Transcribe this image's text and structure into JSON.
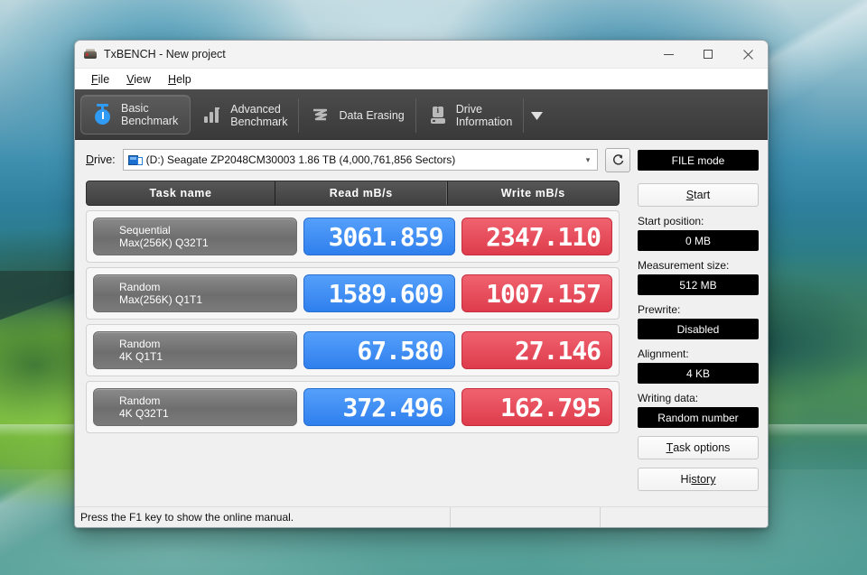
{
  "window": {
    "title": "TxBENCH - New project",
    "icon": "app-icon",
    "controls": {
      "minimize": "minimize-icon",
      "maximize": "maximize-icon",
      "close": "close-icon"
    }
  },
  "menubar": {
    "items": [
      {
        "pre": "F",
        "mnemonic": "",
        "label": "File",
        "m_first": "F",
        "m_rest": "ile"
      },
      {
        "label": "View",
        "m_first": "V",
        "m_rest": "iew"
      },
      {
        "label": "Help",
        "m_first": "H",
        "m_rest": "elp"
      }
    ]
  },
  "toolbar": {
    "tabs": [
      {
        "line1": "Basic",
        "line2": "Benchmark",
        "icon": "stopwatch-icon",
        "active": true
      },
      {
        "line1": "Advanced",
        "line2": "Benchmark",
        "icon": "bar-chart-icon",
        "active": false
      },
      {
        "line1": "Data Erasing",
        "line2": "",
        "icon": "shredder-icon",
        "active": false
      },
      {
        "line1": "Drive",
        "line2": "Information",
        "icon": "drive-info-icon",
        "active": false
      }
    ],
    "overflow_icon": "chevron-down-icon"
  },
  "drive_row": {
    "label": "Drive:",
    "selected": "(D:) Seagate ZP2048CM30003  1.86 TB (4,000,761,856 Sectors)",
    "dropdown_icon": "chevron-down-icon",
    "refresh_icon": "refresh-icon"
  },
  "results": {
    "columns": [
      "Task name",
      "Read mB/s",
      "Write mB/s"
    ],
    "rows": [
      {
        "name_line1": "Sequential",
        "name_line2": "Max(256K) Q32T1",
        "read": "3061.859",
        "write": "2347.110"
      },
      {
        "name_line1": "Random",
        "name_line2": "Max(256K) Q1T1",
        "read": "1589.609",
        "write": "1007.157"
      },
      {
        "name_line1": "Random",
        "name_line2": "4K Q1T1",
        "read": "67.580",
        "write": "27.146"
      },
      {
        "name_line1": "Random",
        "name_line2": "4K Q32T1",
        "read": "372.496",
        "write": "162.795"
      }
    ]
  },
  "sidebar": {
    "mode_button": "FILE mode",
    "start_button": {
      "m_first": "S",
      "m_rest": "tart"
    },
    "start_position": {
      "label": "Start position:",
      "value": "0 MB"
    },
    "measurement_size": {
      "label": "Measurement size:",
      "value": "512 MB"
    },
    "prewrite": {
      "label": "Prewrite:",
      "value": "Disabled"
    },
    "alignment": {
      "label": "Alignment:",
      "value": "4 KB"
    },
    "writing_data": {
      "label": "Writing data:",
      "value": "Random number"
    },
    "task_options": {
      "m_first": "T",
      "m_rest": "ask options"
    },
    "history": {
      "m_first": "Hi",
      "m_rest": "story"
    }
  },
  "statusbar": {
    "message": "Press the F1 key to show the online manual.",
    "cell2": "",
    "cell3": ""
  },
  "colors": {
    "read": "#3d8ef5",
    "write": "#e8505e",
    "toolbar": "#434343",
    "accent_black": "#000000"
  }
}
